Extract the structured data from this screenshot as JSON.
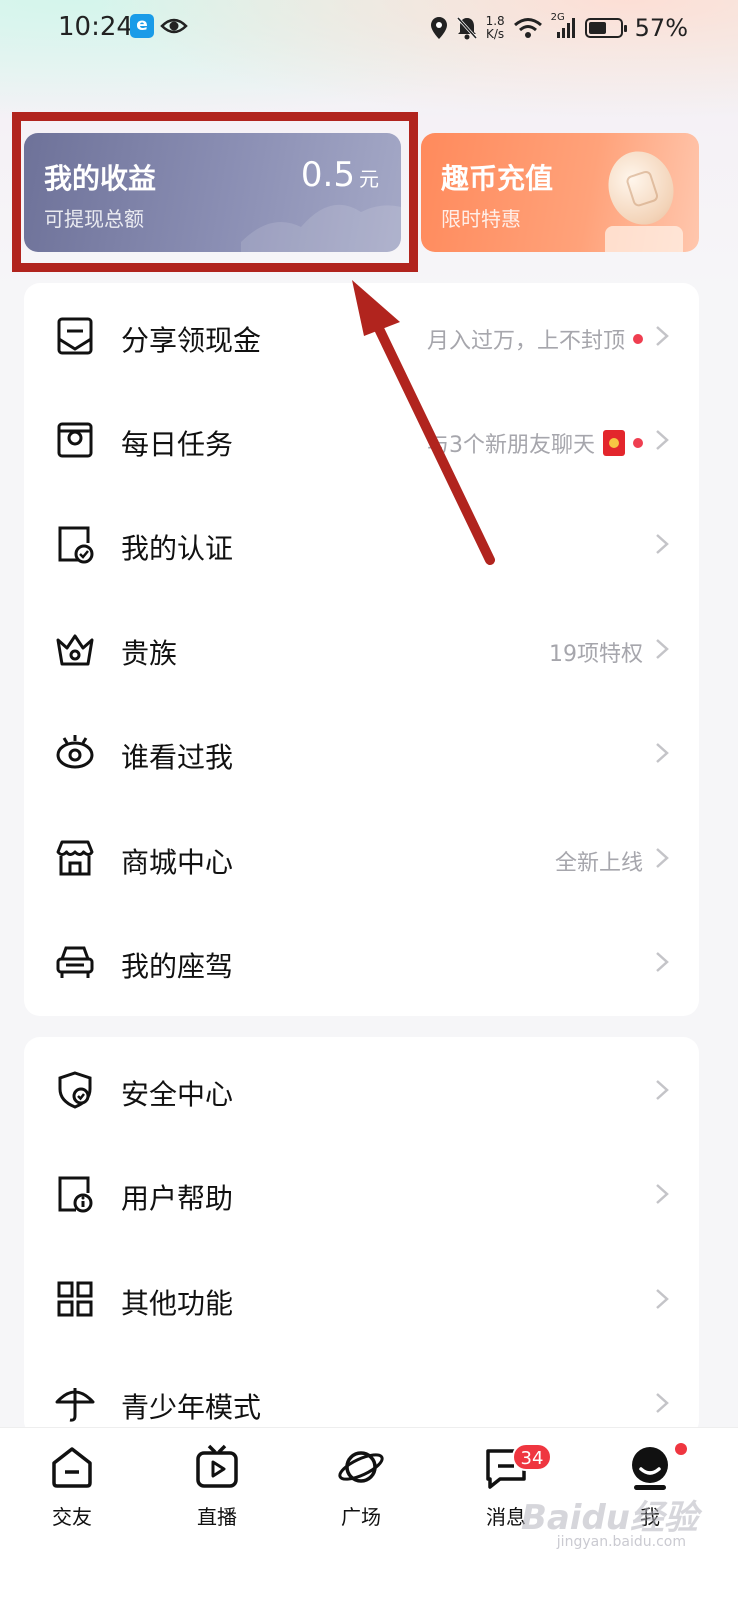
{
  "status_bar": {
    "time": "10:24",
    "e_badge": "e",
    "speed_value": "1.8",
    "speed_unit": "K/s",
    "network": "2G",
    "battery_level": 0.57,
    "battery_text": "57%"
  },
  "cards": {
    "earnings": {
      "title": "我的收益",
      "subtitle": "可提现总额",
      "amount": "0.5",
      "unit": "元"
    },
    "recharge": {
      "title": "趣币充值",
      "subtitle": "限时特惠"
    }
  },
  "menu_group_1": [
    {
      "label": "分享领现金",
      "right": "月入过万，上不封顶",
      "icon": "envelope-share-icon"
    },
    {
      "label": "每日任务",
      "right": "与3个新朋友聊天",
      "icon": "task-icon"
    },
    {
      "label": "我的认证",
      "right": "",
      "icon": "verified-doc-icon"
    },
    {
      "label": "贵族",
      "right": "19项特权",
      "icon": "crown-icon"
    },
    {
      "label": "谁看过我",
      "right": "",
      "icon": "eye-icon"
    },
    {
      "label": "商城中心",
      "right": "全新上线",
      "icon": "store-icon"
    },
    {
      "label": "我的座驾",
      "right": "",
      "icon": "car-icon"
    }
  ],
  "menu_group_2": [
    {
      "label": "安全中心",
      "icon": "shield-icon"
    },
    {
      "label": "用户帮助",
      "icon": "help-doc-icon"
    },
    {
      "label": "其他功能",
      "icon": "grid-icon"
    },
    {
      "label": "青少年模式",
      "icon": "umbrella-icon"
    }
  ],
  "bottom_nav": {
    "items": [
      {
        "label": "交友",
        "icon": "home-icon"
      },
      {
        "label": "直播",
        "icon": "tv-play-icon"
      },
      {
        "label": "广场",
        "icon": "planet-icon"
      },
      {
        "label": "消息",
        "icon": "message-icon",
        "badge": "34"
      },
      {
        "label": "我",
        "icon": "profile-icon"
      }
    ]
  },
  "watermark": {
    "text": "Baidu经验",
    "sub": "jingyan.baidu.com"
  },
  "colors": {
    "highlight_red": "#b1241e",
    "earn_card": "#7d81a8",
    "recharge_card": "#ff9366",
    "dot_red": "#ef3e50"
  }
}
